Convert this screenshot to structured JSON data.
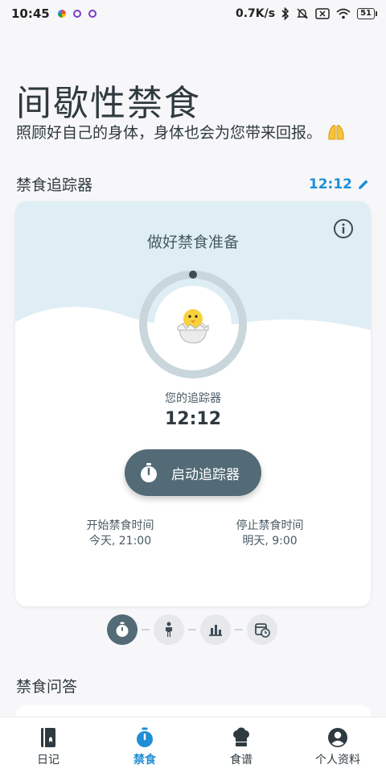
{
  "status_bar": {
    "time": "10:45",
    "network_speed": "0.7K/s",
    "battery": "51"
  },
  "header": {
    "title": "间歇性禁食",
    "subtitle": "照顾好自己的身体，身体也会为您带来回报。"
  },
  "tracker_section": {
    "label": "禁食追踪器",
    "current_time": "12:12"
  },
  "card": {
    "prep_text": "做好禁食准备",
    "your_tracker_label": "您的追踪器",
    "tracker_value": "12:12",
    "start_button_label": "启动追踪器",
    "start_label": "开始禁食时间",
    "start_value": "今天, 21:00",
    "stop_label": "停止禁食时间",
    "stop_value": "明天, 9:00"
  },
  "faq": {
    "label": "禁食问答"
  },
  "nav": {
    "items": [
      {
        "label": "日记",
        "icon": "journal-icon"
      },
      {
        "label": "禁食",
        "icon": "stopwatch-icon"
      },
      {
        "label": "食谱",
        "icon": "chef-hat-icon"
      },
      {
        "label": "个人资料",
        "icon": "profile-icon"
      }
    ],
    "active_index": 1
  },
  "colors": {
    "accent": "#1e8fd6",
    "button": "#536b76",
    "wave": "#dfeef5"
  }
}
